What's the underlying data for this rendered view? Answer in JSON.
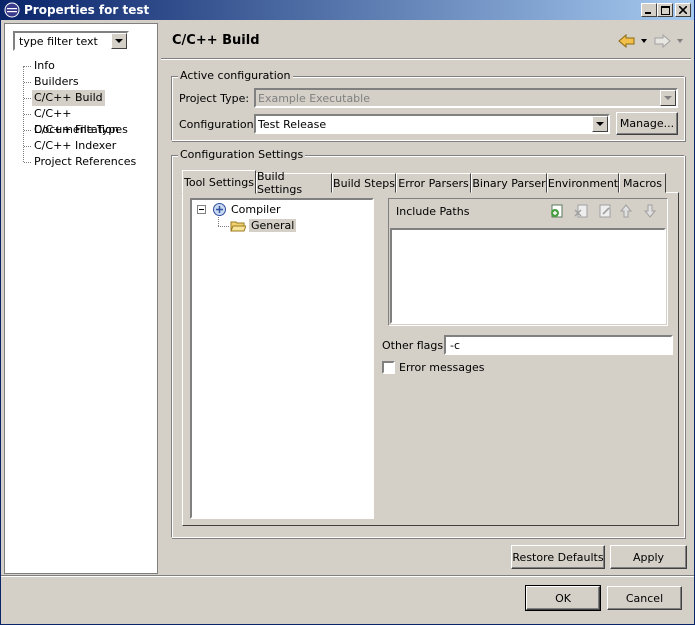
{
  "window": {
    "title": "Properties for test"
  },
  "filter": {
    "placeholder": "type filter text"
  },
  "nav": {
    "items": [
      {
        "label": "Info"
      },
      {
        "label": "Builders"
      },
      {
        "label": "C/C++ Build"
      },
      {
        "label": "C/C++ Documentation"
      },
      {
        "label": "C/C++ File Types"
      },
      {
        "label": "C/C++ Indexer"
      },
      {
        "label": "Project References"
      }
    ],
    "selected": "C/C++ Build"
  },
  "page": {
    "title": "C/C++ Build"
  },
  "active_config": {
    "group_label": "Active configuration",
    "project_type_label": "Project Type:",
    "project_type_value": "Example Executable",
    "configuration_label": "Configuration:",
    "configuration_value": "Test Release",
    "manage_label": "Manage..."
  },
  "config_settings": {
    "group_label": "Configuration Settings",
    "tabs": [
      {
        "label": "Tool Settings"
      },
      {
        "label": "Build Settings"
      },
      {
        "label": "Build Steps"
      },
      {
        "label": "Error Parsers"
      },
      {
        "label": "Binary Parser"
      },
      {
        "label": "Environment"
      },
      {
        "label": "Macros"
      }
    ],
    "active_tab": "Tool Settings",
    "tool_tree": {
      "root": "Compiler",
      "child": "General"
    },
    "include_paths_label": "Include Paths",
    "other_flags_label": "Other flags",
    "other_flags_value": "-c",
    "error_messages_label": "Error messages",
    "error_messages_checked": false
  },
  "buttons": {
    "restore_defaults": "Restore Defaults",
    "apply": "Apply",
    "ok": "OK",
    "cancel": "Cancel"
  },
  "colors": {
    "titlebar_start": "#0a246a",
    "titlebar_end": "#a6caf0",
    "face": "#d4d0c8"
  }
}
